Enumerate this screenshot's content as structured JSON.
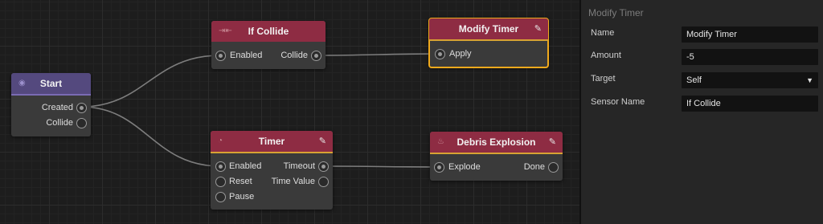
{
  "nodes": {
    "start": {
      "title": "Start",
      "icon": "start-circle-icon",
      "outputs": [
        "Created",
        "Collide"
      ]
    },
    "if_collide": {
      "title": "If Collide",
      "icon": "collide-arrows-icon",
      "inputs": [
        "Enabled"
      ],
      "outputs": [
        "Collide"
      ]
    },
    "modify_timer": {
      "title": "Modify Timer",
      "icon": "pencil-icon",
      "inputs": [
        "Apply"
      ]
    },
    "timer": {
      "title": "Timer",
      "icon": "stopwatch-icon",
      "edit_icon": "pencil-icon",
      "inputs": [
        "Enabled",
        "Reset",
        "Pause"
      ],
      "outputs": [
        "Timeout",
        "Time Value"
      ]
    },
    "debris_explosion": {
      "title": "Debris Explosion",
      "icon": "flame-icon",
      "edit_icon": "pencil-icon",
      "inputs": [
        "Explode"
      ],
      "outputs": [
        "Done"
      ]
    }
  },
  "inspector": {
    "title": "Modify Timer",
    "fields": [
      {
        "label": "Name",
        "value": "Modify Timer"
      },
      {
        "label": "Amount",
        "value": "-5"
      },
      {
        "label": "Target",
        "value": "Self"
      },
      {
        "label": "Sensor Name",
        "value": "If Collide"
      }
    ]
  },
  "colors": {
    "canvas_bg": "#1d1d1d",
    "node_body": "#3a3a3a",
    "action_header": "#8e2c43",
    "event_header": "#54497e",
    "selection_outline": "#f0a91c",
    "header_accent": "#d8a233",
    "wire": "#7d7d7d"
  }
}
